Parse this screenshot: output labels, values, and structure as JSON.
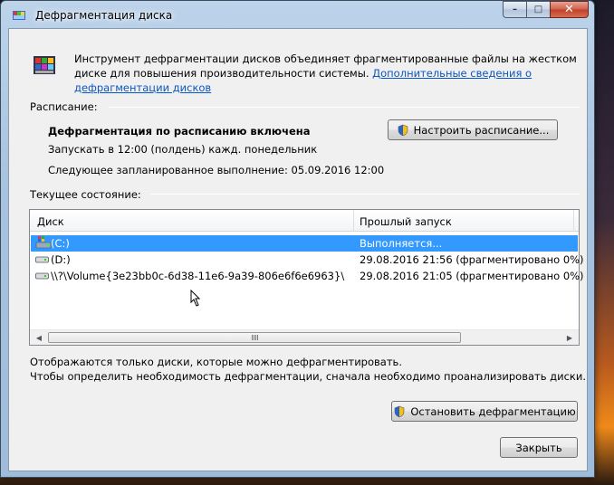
{
  "window": {
    "title": "Дефрагментация диска",
    "caption": {
      "minimize": "–",
      "maximize": "□",
      "close": "✕"
    }
  },
  "intro": {
    "text": "Инструмент дефрагментации дисков объединяет фрагментированные файлы на жестком диске для повышения производительности системы. ",
    "link": "Дополнительные сведения о дефрагментации дисков"
  },
  "schedule": {
    "group_label": "Расписание:",
    "status": "Дефрагментация по расписанию включена",
    "run_time": "Запускать в 12:00 (полдень) кажд. понедельник",
    "next_run": "Следующее запланированное выполнение: 05.09.2016 12:00",
    "configure_button": "Настроить расписание..."
  },
  "current": {
    "group_label": "Текущее состояние:",
    "columns": [
      "Диск",
      "Прошлый запуск"
    ],
    "rows": [
      {
        "disk": "(C:)",
        "last_run": "Выполняется...",
        "selected": true
      },
      {
        "disk": "(D:)",
        "last_run": "29.08.2016 21:56 (фрагментировано 0%)",
        "selected": false
      },
      {
        "disk": "\\\\?\\Volume{3e23bb0c-6d38-11e6-9a39-806e6f6e6963}\\",
        "last_run": "29.08.2016 21:05 (фрагментировано 0%)",
        "selected": false
      }
    ]
  },
  "notes": {
    "line1": "Отображаются только диски, которые можно дефрагментировать.",
    "line2": "Чтобы определить необходимость  дефрагментации, сначала необходимо проанализировать диски."
  },
  "buttons": {
    "stop": "Остановить дефрагментацию",
    "close": "Закрыть"
  },
  "colors": {
    "accent": "#3399ff",
    "link": "#0a57c2"
  }
}
